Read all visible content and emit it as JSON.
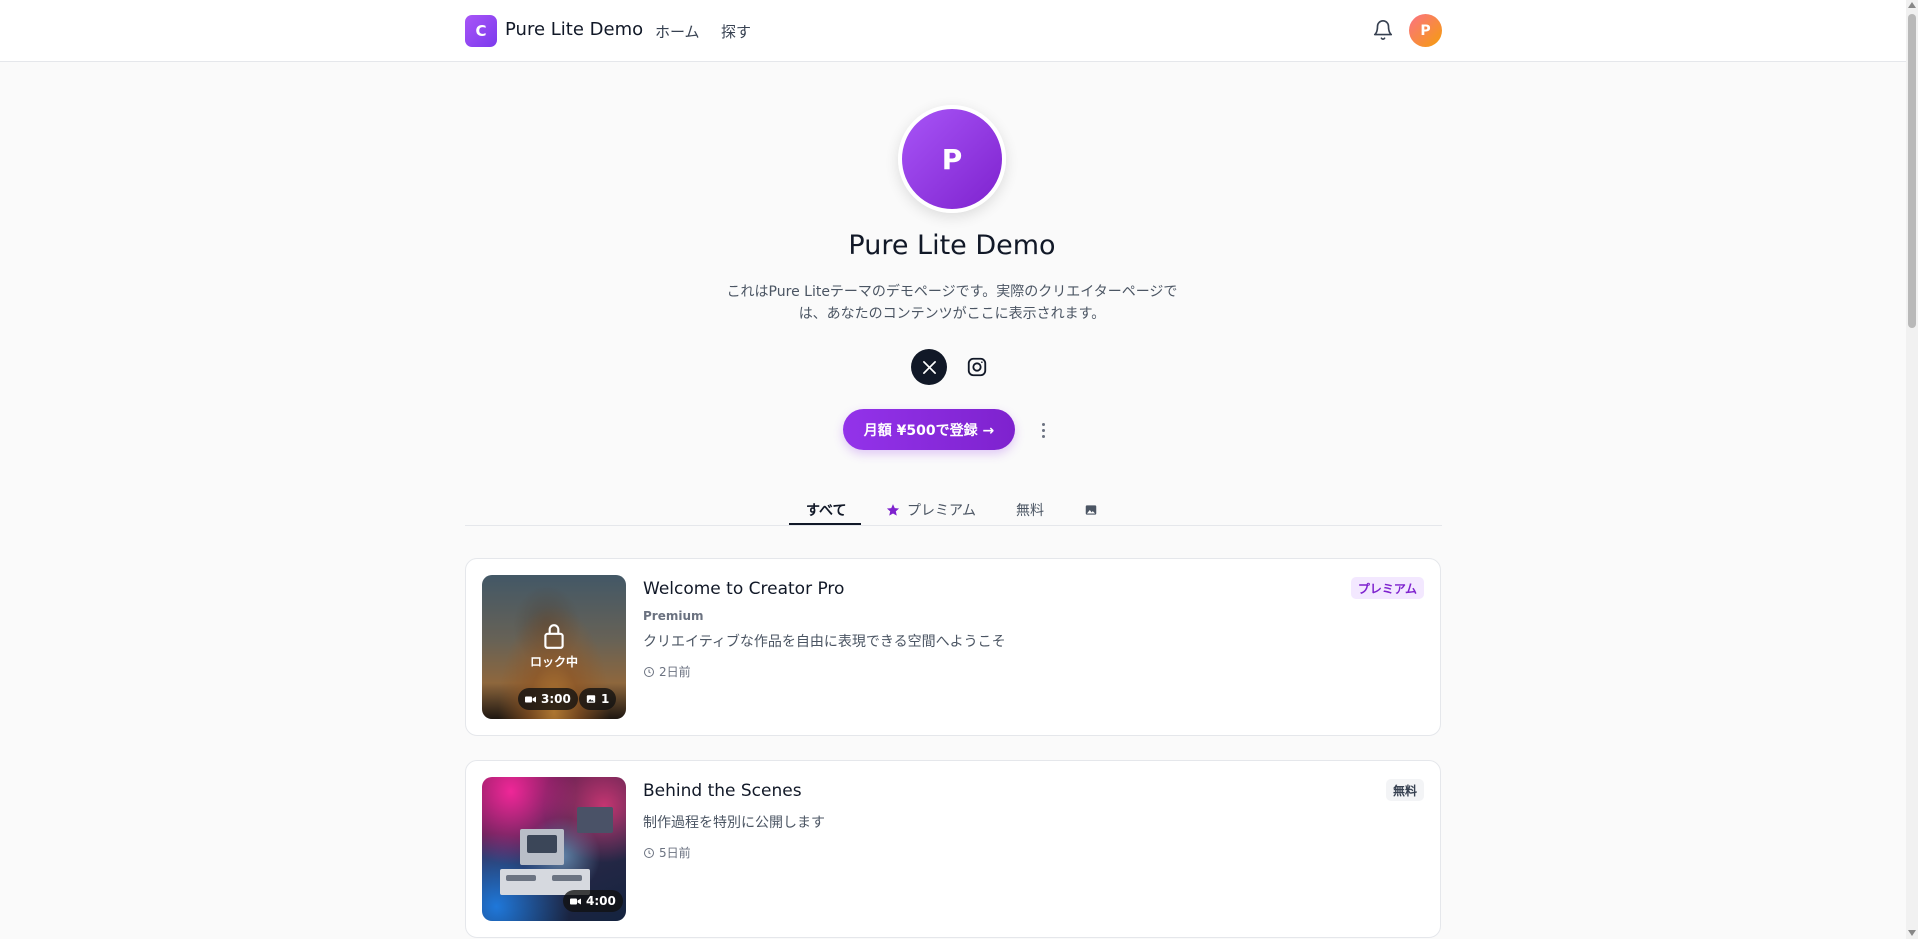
{
  "header": {
    "logo_letter": "C",
    "site_title": "Pure Lite Demo",
    "nav": [
      "ホーム",
      "探す"
    ],
    "user_initial": "P"
  },
  "profile": {
    "initial": "P",
    "name": "Pure Lite Demo",
    "description": "これはPure Liteテーマのデモページです。実際のクリエイターページでは、あなたのコンテンツがここに表示されます。",
    "socials": [
      "x-icon",
      "instagram-icon"
    ],
    "subscribe_label": "月額 ¥500で登録 →"
  },
  "tabs": {
    "all": "すべて",
    "premium": "プレミアム",
    "free": "無料",
    "active": "すべて"
  },
  "posts": [
    {
      "title": "Welcome to Creator Pro",
      "subtitle": "Premium",
      "description": "クリエイティブな作品を自由に表現できる空間へようこそ",
      "time": "2日前",
      "badge": "プレミアム",
      "lock_label": "ロック中",
      "video_duration": "3:00",
      "image_count": "1"
    },
    {
      "title": "Behind the Scenes",
      "description": "制作過程を特別に公開します",
      "time": "5日前",
      "badge": "無料",
      "video_duration": "4:00"
    }
  ],
  "colors": {
    "accent": "#9333ea",
    "premium_badge_bg": "#f3e8ff",
    "premium_badge_text": "#7e22ce"
  }
}
